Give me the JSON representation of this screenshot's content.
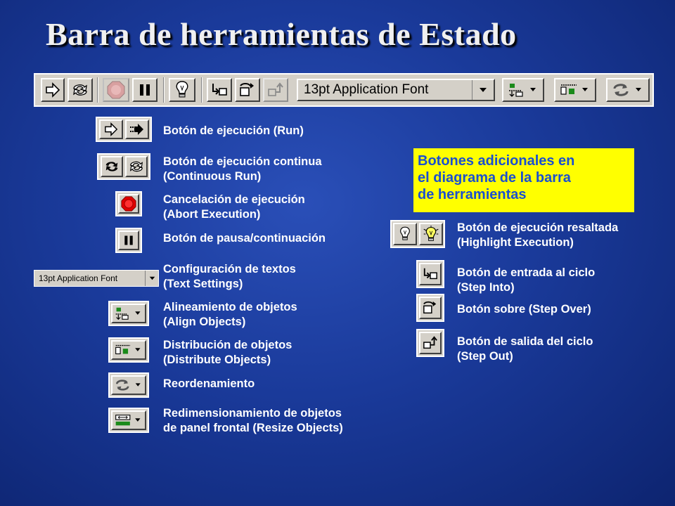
{
  "title": "Barra de herramientas de Estado",
  "toolbar": {
    "font_setting": "13pt Application Font"
  },
  "left_items": [
    {
      "line1": "Botón de ejecución (Run)",
      "line2": ""
    },
    {
      "line1": "Botón de ejecución continua",
      "line2": "(Continuous Run)"
    },
    {
      "line1": "Cancelación de ejecución",
      "line2": "(Abort Execution)"
    },
    {
      "line1": "Botón de pausa/continuación",
      "line2": ""
    },
    {
      "line1": "Configuración de textos",
      "line2": "(Text Settings)"
    },
    {
      "line1": "Alineamiento de objetos",
      "line2": "(Align Objects)"
    },
    {
      "line1": "Distribución de objetos",
      "line2": "(Distribute Objects)"
    },
    {
      "line1": "Reordenamiento",
      "line2": ""
    },
    {
      "line1": "Redimensionamiento de objetos",
      "line2": "de panel frontal (Resize Objects)"
    }
  ],
  "small_font_combo": "13pt Application Font",
  "note": {
    "line1": "Botones adicionales en",
    "line2": "el diagrama de la barra",
    "line3": "de herramientas"
  },
  "right_items": [
    {
      "line1": "Botón de ejecución resaltada",
      "line2": "(Highlight Execution)"
    },
    {
      "line1": "Botón de entrada al ciclo",
      "line2": "(Step Into)"
    },
    {
      "line1": "Botón sobre (Step Over)",
      "line2": ""
    },
    {
      "line1": "Botón de salida del ciclo",
      "line2": "(Step Out)"
    }
  ],
  "colors": {
    "background": "#1a3a9a",
    "toolbar": "#d4d0c8",
    "note_bg": "#ffff00",
    "note_text": "#1a4fd0",
    "abort_red": "#e00000"
  },
  "icons": [
    "run-icon",
    "run-continuously-icon",
    "abort-icon",
    "pause-icon",
    "highlight-execution-icon",
    "step-into-icon",
    "step-over-icon",
    "step-out-icon",
    "align-objects-icon",
    "distribute-objects-icon",
    "reorder-icon",
    "resize-objects-icon"
  ]
}
